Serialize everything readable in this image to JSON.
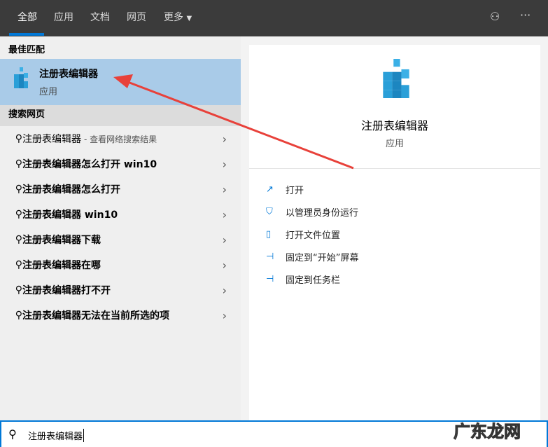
{
  "tabs": [
    {
      "label": "全部",
      "active": true
    },
    {
      "label": "应用"
    },
    {
      "label": "文档"
    },
    {
      "label": "网页"
    },
    {
      "label": "更多"
    }
  ],
  "best_match": {
    "header": "最佳匹配",
    "name": "注册表编辑器",
    "type": "应用"
  },
  "web": {
    "header": "搜索网页",
    "items": [
      {
        "text": "注册表编辑器",
        "sub": "- 查看网络搜索结果"
      },
      {
        "text": "注册表编辑器怎么打开 win10"
      },
      {
        "text": "注册表编辑器怎么打开"
      },
      {
        "text": "注册表编辑器 win10"
      },
      {
        "text": "注册表编辑器下载"
      },
      {
        "text": "注册表编辑器在哪"
      },
      {
        "text": "注册表编辑器打不开"
      },
      {
        "text": "注册表编辑器无法在当前所选的项"
      }
    ]
  },
  "detail": {
    "name": "注册表编辑器",
    "type": "应用",
    "actions": [
      "打开",
      "以管理员身份运行",
      "打开文件位置",
      "固定到“开始”屏幕",
      "固定到任务栏"
    ]
  },
  "search": {
    "value": "注册表编辑器"
  },
  "watermark": "广东龙网",
  "colors": {
    "accent": "#0078d7",
    "selected": "#a9cbe8",
    "arrow": "#e8413a"
  }
}
